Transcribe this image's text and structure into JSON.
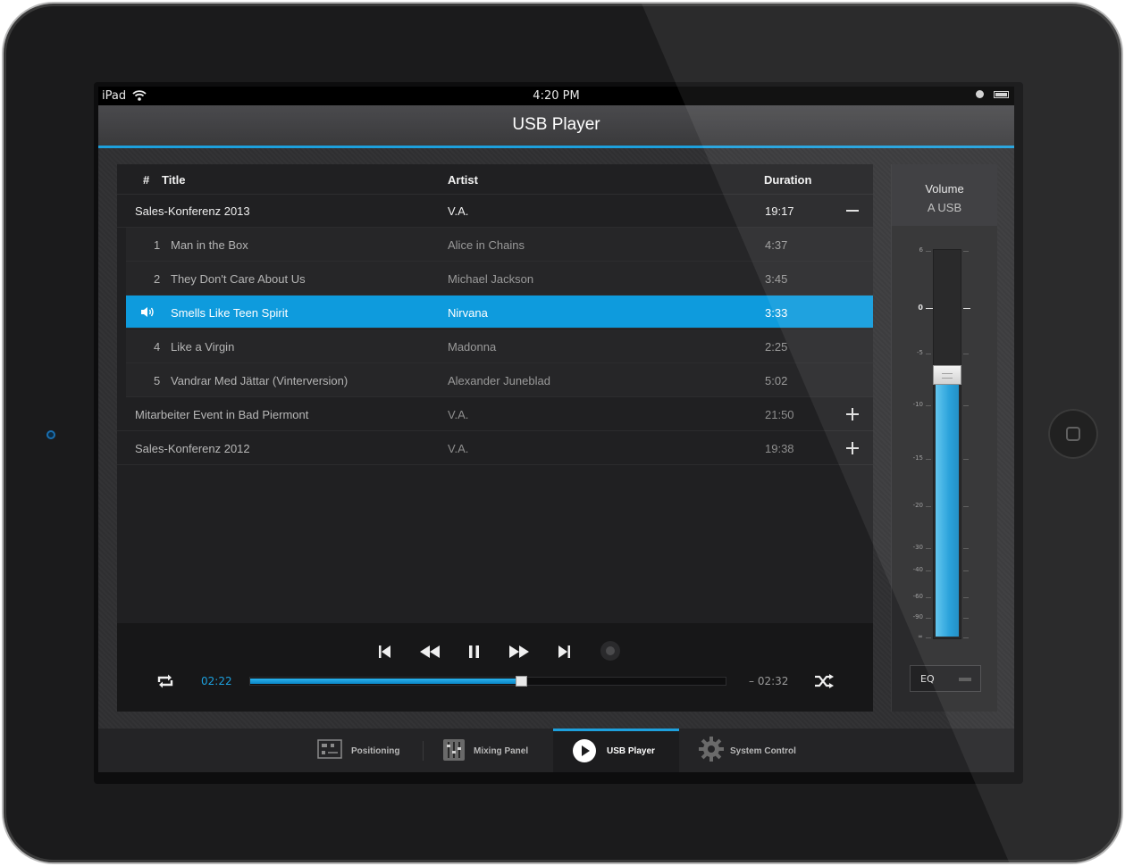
{
  "status_bar": {
    "device": "iPad",
    "time": "4:20 PM"
  },
  "nav": {
    "title": "USB Player"
  },
  "playlist": {
    "headers": {
      "number": "#",
      "title": "Title",
      "artist": "Artist",
      "duration": "Duration"
    },
    "albums": [
      {
        "title": "Sales-Konferenz 2013",
        "artist": "V.A.",
        "duration": "19:17",
        "expanded": true,
        "tracks": [
          {
            "number": "1",
            "title": "Man in the Box",
            "artist": "Alice in Chains",
            "duration": "4:37"
          },
          {
            "number": "2",
            "title": "They Don't Care About Us",
            "artist": "Michael Jackson",
            "duration": "3:45"
          },
          {
            "number": "",
            "title": "Smells Like Teen Spirit",
            "artist": "Nirvana",
            "duration": "3:33",
            "playing": true
          },
          {
            "number": "4",
            "title": "Like a Virgin",
            "artist": "Madonna",
            "duration": "2:25"
          },
          {
            "number": "5",
            "title": "Vandrar Med Jättar (Vinterversion)",
            "artist": "Alexander Juneblad",
            "duration": "5:02"
          }
        ]
      },
      {
        "title": "Mitarbeiter Event in Bad Piermont",
        "artist": "V.A.",
        "duration": "21:50",
        "expanded": false
      },
      {
        "title": "Sales-Konferenz 2012",
        "artist": "V.A.",
        "duration": "19:38",
        "expanded": false
      }
    ]
  },
  "transport": {
    "elapsed": "02:22",
    "remaining": "– 02:32",
    "progress": 0.57,
    "icons": [
      "skip-back-icon",
      "rewind-icon",
      "pause-icon",
      "fast-forward-icon",
      "skip-forward-icon",
      "record-icon",
      "repeat-icon",
      "shuffle-icon"
    ]
  },
  "volume": {
    "title": "Volume",
    "channel": "A USB",
    "level_db": -7,
    "scale": [
      "6",
      "0",
      "-5",
      "-10",
      "-15",
      "-20",
      "-30",
      "-40",
      "-60",
      "-90",
      "∞"
    ],
    "eq_label": "EQ"
  },
  "tabs": [
    {
      "label": "Positioning",
      "icon": "positioning-icon"
    },
    {
      "label": "Mixing Panel",
      "icon": "mixer-icon"
    },
    {
      "label": "USB Player",
      "icon": "play-icon",
      "active": true
    },
    {
      "label": "System Control",
      "icon": "gear-icon"
    }
  ],
  "colors": {
    "accent": "#1da0dd",
    "selected_row": "#0e9bdd",
    "background": "#202022"
  }
}
